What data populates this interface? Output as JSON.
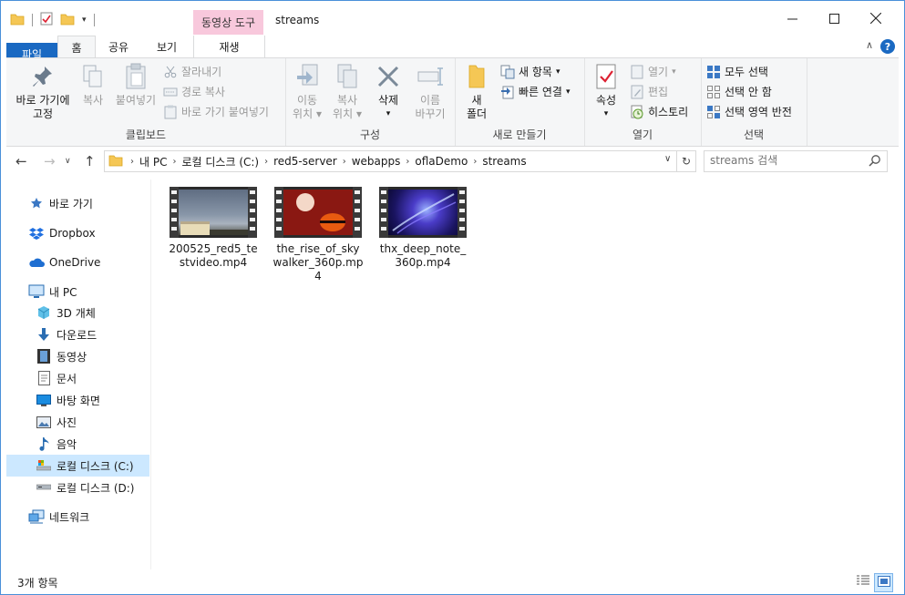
{
  "window": {
    "title": "streams",
    "context_tab_header": "동영상 도구"
  },
  "ribbon_tabs": {
    "file": "파일",
    "home": "홈",
    "share": "공유",
    "view": "보기",
    "play": "재생"
  },
  "ribbon": {
    "clipboard": {
      "label": "클립보드",
      "pin": [
        "바로 가기에",
        "고정"
      ],
      "copy": "복사",
      "paste": "붙여넣기",
      "cut": "잘라내기",
      "copy_path": "경로 복사",
      "paste_shortcut": "바로 가기 붙여넣기"
    },
    "organize": {
      "label": "구성",
      "move_to": [
        "이동",
        "위치"
      ],
      "copy_to": [
        "복사",
        "위치"
      ],
      "delete": "삭제",
      "rename": [
        "이름",
        "바꾸기"
      ]
    },
    "new": {
      "label": "새로 만들기",
      "new_folder": [
        "새",
        "폴더"
      ],
      "new_item": "새 항목",
      "easy_access": "빠른 연결"
    },
    "open": {
      "label": "열기",
      "properties": "속성",
      "open": "열기",
      "edit": "편집",
      "history": "히스토리"
    },
    "select": {
      "label": "선택",
      "select_all": "모두 선택",
      "select_none": "선택 안 함",
      "invert": "선택 영역 반전"
    }
  },
  "address": {
    "breadcrumbs": [
      "내 PC",
      "로컬 디스크 (C:)",
      "red5-server",
      "webapps",
      "oflaDemo",
      "streams"
    ],
    "search_placeholder": "streams 검색"
  },
  "nav_pane": {
    "items": [
      {
        "label": "바로 가기",
        "icon": "star-icon"
      },
      {
        "label": "Dropbox",
        "icon": "dropbox-icon"
      },
      {
        "label": "OneDrive",
        "icon": "cloud-icon"
      },
      {
        "label": "내 PC",
        "icon": "computer-icon"
      },
      {
        "label": "3D 개체",
        "icon": "cube-icon"
      },
      {
        "label": "다운로드",
        "icon": "download-icon"
      },
      {
        "label": "동영상",
        "icon": "video-icon"
      },
      {
        "label": "문서",
        "icon": "document-icon"
      },
      {
        "label": "바탕 화면",
        "icon": "desktop-icon"
      },
      {
        "label": "사진",
        "icon": "pictures-icon"
      },
      {
        "label": "음악",
        "icon": "music-icon"
      },
      {
        "label": "로컬 디스크 (C:)",
        "icon": "drive-icon",
        "selected": true
      },
      {
        "label": "로컬 디스크 (D:)",
        "icon": "drive-icon"
      },
      {
        "label": "네트워크",
        "icon": "network-icon"
      }
    ]
  },
  "files": [
    {
      "name": "200525_red5_testvideo.mp4",
      "thumb": "sky-building"
    },
    {
      "name": "the_rise_of_skywalker_360p.mp4",
      "thumb": "red-sun"
    },
    {
      "name": "thx_deep_note_360p.mp4",
      "thumb": "blue-space"
    }
  ],
  "status": {
    "item_count": "3개 항목"
  },
  "colors": {
    "accent": "#1a69c2",
    "context_tab": "#f8c8dc",
    "selection": "#cce8ff"
  }
}
